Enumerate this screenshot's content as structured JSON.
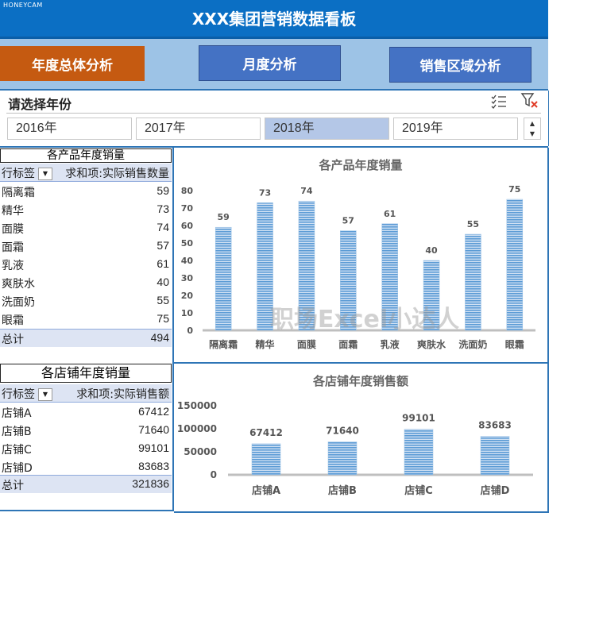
{
  "watermark": "HONEYCAM",
  "header": {
    "title": "XXX集团营销数据看板"
  },
  "nav": {
    "annual": "年度总体分析",
    "monthly": "月度分析",
    "region": "销售区域分析"
  },
  "slicer": {
    "title": "请选择年份",
    "years": [
      "2016年",
      "2017年",
      "2018年",
      "2019年"
    ],
    "selected": "2018年",
    "icons": [
      "multi-select-icon",
      "clear-filter-icon"
    ]
  },
  "pivot_products": {
    "title": "各产品年度销量",
    "col_label": "行标签",
    "col_value": "求和项:实际销售数量",
    "rows": [
      {
        "name": "隔离霜",
        "value": "59"
      },
      {
        "name": "精华",
        "value": "73"
      },
      {
        "name": "面膜",
        "value": "74"
      },
      {
        "name": "面霜",
        "value": "57"
      },
      {
        "name": "乳液",
        "value": "61"
      },
      {
        "name": "爽肤水",
        "value": "40"
      },
      {
        "name": "洗面奶",
        "value": "55"
      },
      {
        "name": "眼霜",
        "value": "75"
      }
    ],
    "total_label": "总计",
    "total_value": "494"
  },
  "pivot_stores": {
    "title": "各店铺年度销量",
    "col_label": "行标签",
    "col_value": "求和项:实际销售额",
    "rows": [
      {
        "name": "店铺A",
        "value": "67412"
      },
      {
        "name": "店铺B",
        "value": "71640"
      },
      {
        "name": "店铺C",
        "value": "99101"
      },
      {
        "name": "店铺D",
        "value": "83683"
      }
    ],
    "total_label": "总计",
    "total_value": "321836"
  },
  "chart_watermark": "职场Excel小达人",
  "colors": {
    "bar": "#5b9bd5",
    "header": "#0b6fc4",
    "accent": "#c55a11",
    "nav": "#4472c4"
  },
  "chart_data": [
    {
      "type": "bar",
      "title": "各产品年度销量",
      "categories": [
        "隔离霜",
        "精华",
        "面膜",
        "面霜",
        "乳液",
        "爽肤水",
        "洗面奶",
        "眼霜"
      ],
      "values": [
        59,
        73,
        74,
        57,
        61,
        40,
        55,
        75
      ],
      "ylim": [
        0,
        80
      ],
      "yticks": [
        0,
        10,
        20,
        30,
        40,
        50,
        60,
        70,
        80
      ],
      "grid": false,
      "data_labels": true
    },
    {
      "type": "bar",
      "title": "各店铺年度销售额",
      "categories": [
        "店铺A",
        "店铺B",
        "店铺C",
        "店铺D"
      ],
      "values": [
        67412,
        71640,
        99101,
        83683
      ],
      "ylim": [
        0,
        150000
      ],
      "yticks": [
        0,
        50000,
        100000,
        150000
      ],
      "grid": false,
      "data_labels": true
    }
  ]
}
